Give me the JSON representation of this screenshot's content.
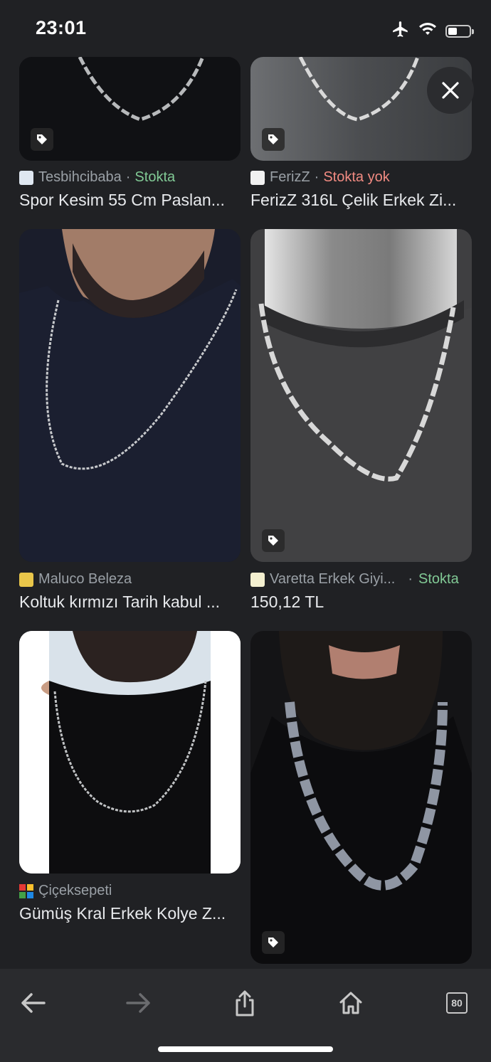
{
  "status_bar": {
    "time": "23:01"
  },
  "results": [
    {
      "source": "Tesbihcibaba",
      "stock": "Stokta",
      "stock_type": "in",
      "title": "Spor Kesim 55 Cm Paslan..."
    },
    {
      "source": "FerizZ",
      "stock": "Stokta yok",
      "stock_type": "out",
      "title": "FerizZ 316L Çelik Erkek Zi..."
    },
    {
      "source": "Maluco Beleza",
      "stock": "",
      "stock_type": "",
      "title": "Koltuk kırmızı Tarih kabul ..."
    },
    {
      "source": "Varetta Erkek Giyi...",
      "stock": "Stokta",
      "stock_type": "in",
      "title": "150,12 TL"
    },
    {
      "source": "Çiçeksepeti",
      "stock": "",
      "stock_type": "",
      "title": "Gümüş Kral Erkek Kolye Z..."
    }
  ],
  "separator": "·",
  "toolbar": {
    "tab_count": "80"
  },
  "colors": {
    "background": "#202124",
    "in_stock": "#81c995",
    "out_of_stock": "#f28b82",
    "meta": "#9aa0a6"
  },
  "icons": [
    "airplane-icon",
    "wifi-icon",
    "battery-icon",
    "tag-icon",
    "close-icon",
    "back-icon",
    "forward-icon",
    "share-icon",
    "home-icon",
    "tabs-icon"
  ]
}
